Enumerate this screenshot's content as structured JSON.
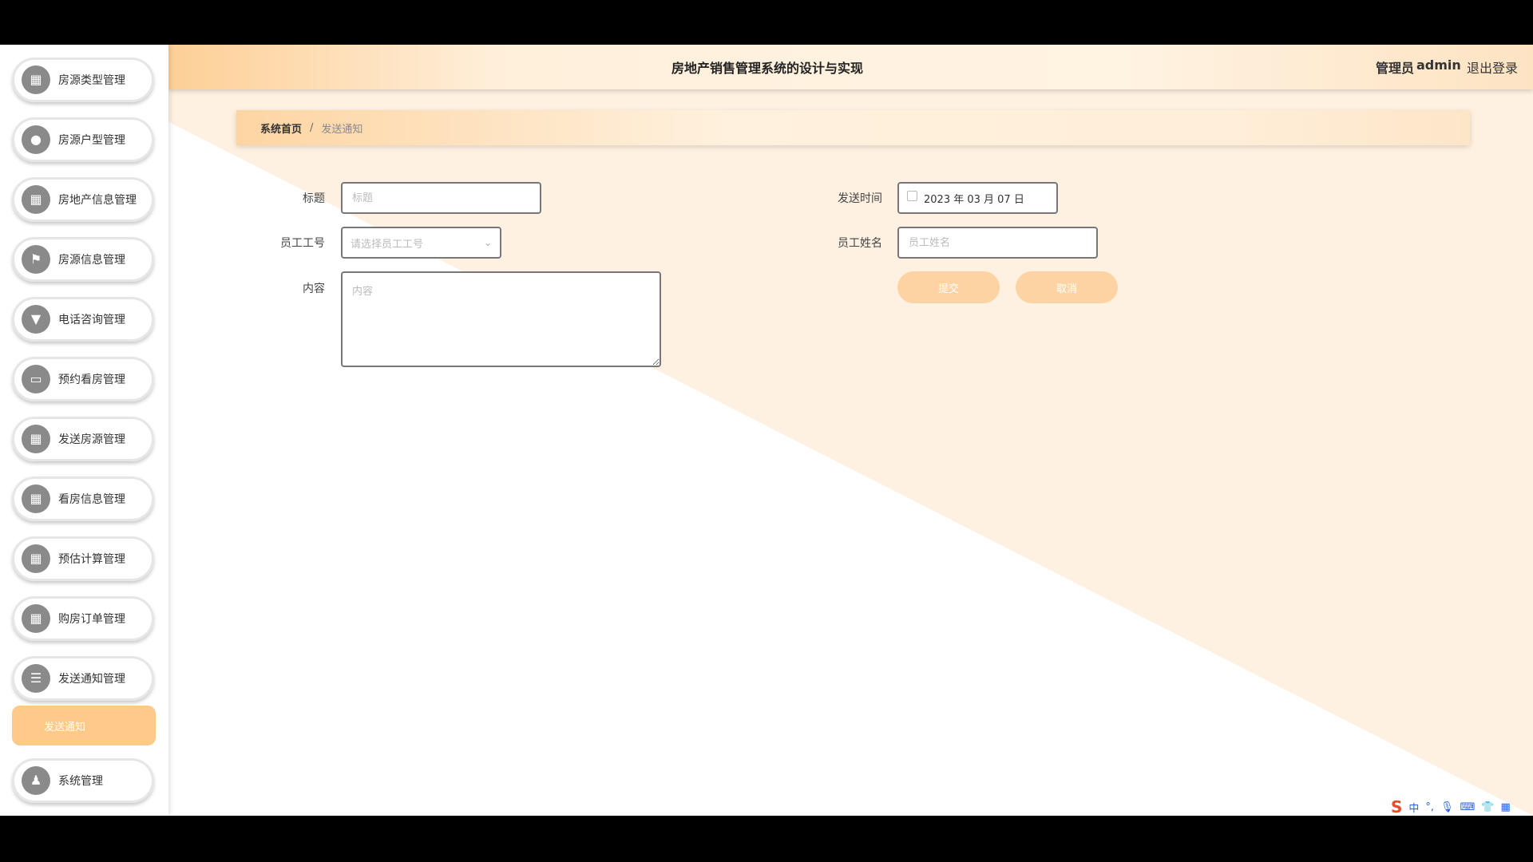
{
  "app": {
    "title": "房地产销售管理系统的设计与实现",
    "user_role": "管理员",
    "user_name": "admin",
    "logout_label": "退出登录"
  },
  "sidebar": {
    "items": [
      {
        "label": "房源类型管理",
        "icon": "grid-icon"
      },
      {
        "label": "房源户型管理",
        "icon": "location-pin-icon"
      },
      {
        "label": "房地产信息管理",
        "icon": "grid-icon"
      },
      {
        "label": "房源信息管理",
        "icon": "flag-icon"
      },
      {
        "label": "电话咨询管理",
        "icon": "chat-bubble-icon"
      },
      {
        "label": "预约看房管理",
        "icon": "monitor-icon"
      },
      {
        "label": "发送房源管理",
        "icon": "grid-icon"
      },
      {
        "label": "看房信息管理",
        "icon": "grid-icon"
      },
      {
        "label": "预估计算管理",
        "icon": "grid-icon"
      },
      {
        "label": "购房订单管理",
        "icon": "grid-icon"
      },
      {
        "label": "发送通知管理",
        "icon": "list-icon"
      }
    ],
    "submenu_active": "发送通知",
    "system_item": {
      "label": "系统管理",
      "icon": "user-icon"
    }
  },
  "breadcrumb": {
    "home": "系统首页",
    "separator": "/",
    "current": "发送通知"
  },
  "form": {
    "title_label": "标题",
    "title_placeholder": "标题",
    "employee_id_label": "员工工号",
    "employee_id_placeholder": "请选择员工工号",
    "content_label": "内容",
    "content_placeholder": "内容",
    "send_time_label": "发送时间",
    "send_time_value": "2023 年 03 月 07 日",
    "employee_name_label": "员工姓名",
    "employee_name_placeholder": "员工姓名",
    "submit_label": "提交",
    "cancel_label": "取消"
  },
  "taskbar": {
    "ime_language": "中",
    "punct": "°,",
    "items": [
      "sogou-logo-icon",
      "microphone-icon",
      "keyboard-icon",
      "shirt-icon",
      "apps-icon"
    ]
  },
  "colors": {
    "accent": "#fdca8a",
    "button": "#fdd3a3",
    "background_wedge": "#fff1e1"
  }
}
